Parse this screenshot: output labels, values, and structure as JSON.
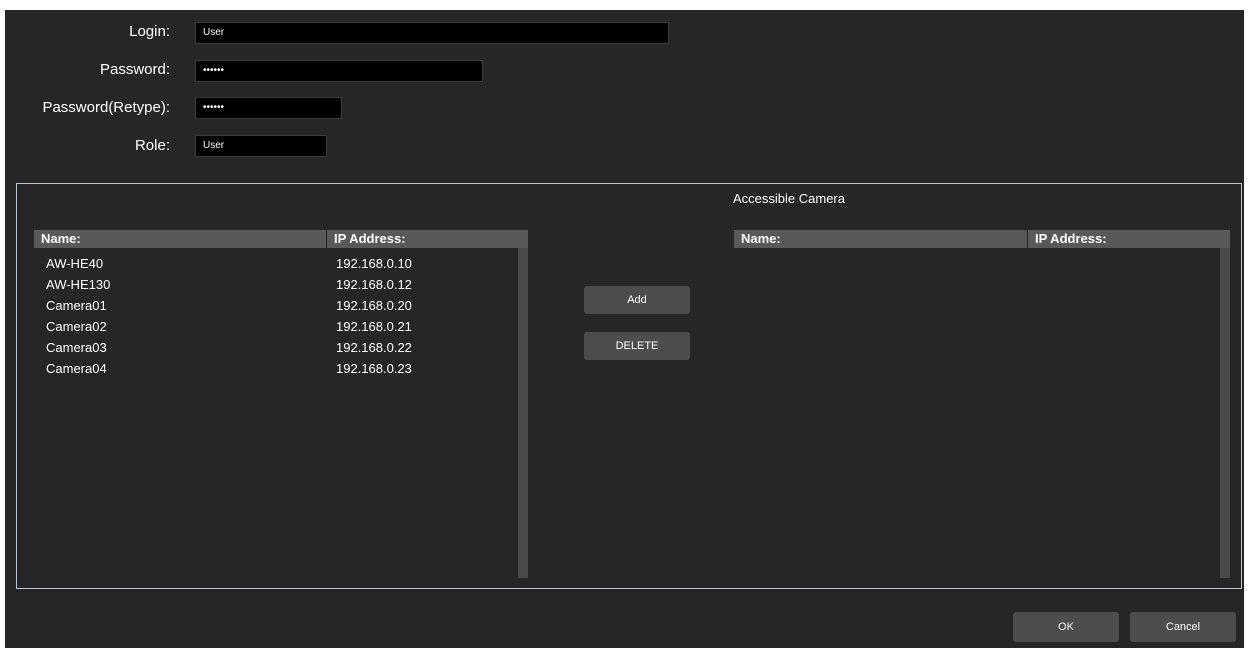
{
  "form": {
    "login_label": "Login:",
    "login_value": "User",
    "password_label": "Password:",
    "password_value": "••••••",
    "password_retype_label": "Password(Retype):",
    "password_retype_value": "••••••",
    "role_label": "Role:",
    "role_value": "User"
  },
  "available_list": {
    "columns": [
      "Name:",
      "IP Address:"
    ],
    "rows": [
      {
        "name": "AW-HE40",
        "ip": "192.168.0.10"
      },
      {
        "name": "AW-HE130",
        "ip": "192.168.0.12"
      },
      {
        "name": "Camera01",
        "ip": "192.168.0.20"
      },
      {
        "name": "Camera02",
        "ip": "192.168.0.21"
      },
      {
        "name": "Camera03",
        "ip": "192.168.0.22"
      },
      {
        "name": "Camera04",
        "ip": "192.168.0.23"
      }
    ]
  },
  "accessible_list": {
    "title": "Accessible Camera",
    "columns": [
      "Name:",
      "IP Address:"
    ],
    "rows": []
  },
  "actions": {
    "add_label": "Add",
    "delete_label": "DELETE"
  },
  "footer": {
    "ok_label": "OK",
    "cancel_label": "Cancel"
  },
  "colors": {
    "dialog_bg": "#262626",
    "input_bg": "#000000",
    "header_bg": "#595959",
    "button_bg": "#4d4d4d",
    "group_border": "#b7c5d4"
  }
}
